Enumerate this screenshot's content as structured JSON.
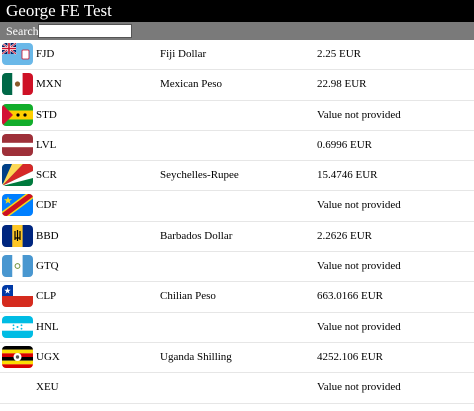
{
  "app": {
    "title": "George FE Test"
  },
  "search": {
    "label": "Search",
    "value": "",
    "placeholder": ""
  },
  "rows": [
    {
      "code": "FJD",
      "name": "Fiji Dollar",
      "value": "2.25 EUR",
      "flag_icon": "flag-fiji-icon"
    },
    {
      "code": "MXN",
      "name": "Mexican Peso",
      "value": "22.98 EUR",
      "flag_icon": "flag-mexico-icon"
    },
    {
      "code": "STD",
      "name": "",
      "value": "Value not provided",
      "flag_icon": "flag-sao-tome-icon"
    },
    {
      "code": "LVL",
      "name": "",
      "value": "0.6996 EUR",
      "flag_icon": "flag-latvia-icon"
    },
    {
      "code": "SCR",
      "name": "Seychelles-Rupee",
      "value": "15.4746 EUR",
      "flag_icon": "flag-seychelles-icon"
    },
    {
      "code": "CDF",
      "name": "",
      "value": "Value not provided",
      "flag_icon": "flag-dr-congo-icon"
    },
    {
      "code": "BBD",
      "name": "Barbados Dollar",
      "value": "2.2626 EUR",
      "flag_icon": "flag-barbados-icon"
    },
    {
      "code": "GTQ",
      "name": "",
      "value": "Value not provided",
      "flag_icon": "flag-guatemala-icon"
    },
    {
      "code": "CLP",
      "name": "Chilian Peso",
      "value": "663.0166 EUR",
      "flag_icon": "flag-chile-icon"
    },
    {
      "code": "HNL",
      "name": "",
      "value": "Value not provided",
      "flag_icon": "flag-honduras-icon"
    },
    {
      "code": "UGX",
      "name": "Uganda Shilling",
      "value": "4252.106 EUR",
      "flag_icon": "flag-uganda-icon"
    },
    {
      "code": "XEU",
      "name": "",
      "value": "Value not provided",
      "flag_icon": ""
    }
  ]
}
